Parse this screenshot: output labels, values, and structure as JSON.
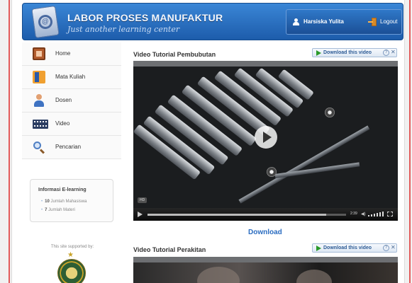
{
  "header": {
    "site_title": "LABOR PROSES MANUFAKTUR",
    "tagline": "Just another learning center",
    "user_name": "Harsiska Yulita",
    "logout_label": "Logout"
  },
  "sidebar": {
    "items": [
      {
        "label": "Home",
        "icon": "home-icon"
      },
      {
        "label": "Mata Kuliah",
        "icon": "book-icon"
      },
      {
        "label": "Dosen",
        "icon": "person-icon"
      },
      {
        "label": "Video",
        "icon": "film-icon"
      },
      {
        "label": "Pencarian",
        "icon": "search-icon"
      }
    ],
    "info": {
      "title": "Informasi E-learning",
      "students_count": "10",
      "students_label": "Jumlah Mahasiswa",
      "materials_count": "7",
      "materials_label": "Jumlah Materi"
    },
    "support_text": "This site supported by:"
  },
  "main": {
    "videos": [
      {
        "title": "Video Tutorial Pembubutan",
        "download_button": "Download this video",
        "hd_badge": "HD",
        "time": "2:39",
        "progress": 0.9
      },
      {
        "title": "Video Tutorial Perakitan",
        "download_button": "Download this video"
      }
    ],
    "download_link": "Download"
  },
  "colors": {
    "header_blue": "#1d5cab",
    "link_blue": "#2a6cc0",
    "play_green": "#2a9a2a"
  }
}
